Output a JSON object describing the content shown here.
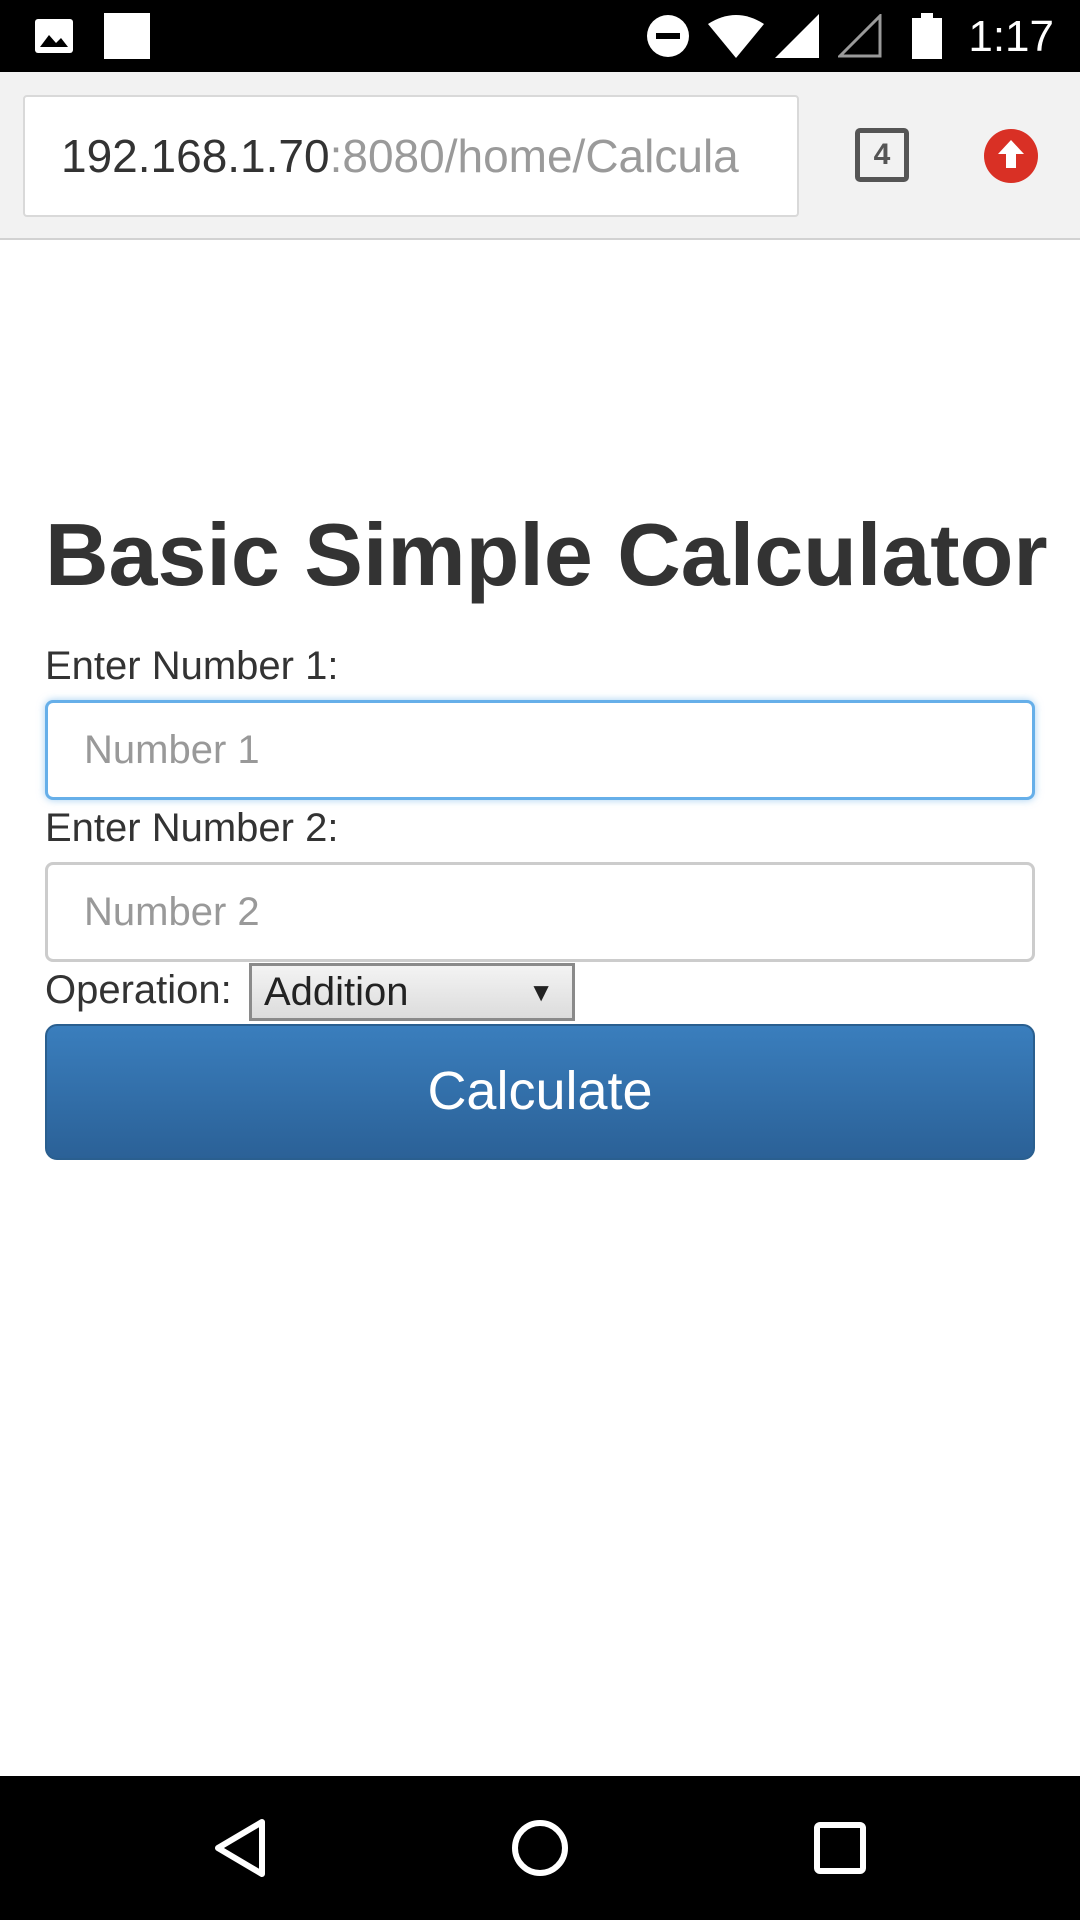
{
  "status_bar": {
    "time": "1:17",
    "icons": [
      "image-icon",
      "notification-square-icon",
      "do-not-disturb-icon",
      "wifi-icon",
      "signal-full-icon",
      "signal-empty-icon",
      "battery-icon"
    ]
  },
  "browser": {
    "url_host": "192.168.1.70",
    "url_path": ":8080/home/Calcula",
    "tab_count": "4",
    "update_badge_color": "#d93025"
  },
  "page": {
    "title": "Basic Simple Calculator",
    "number1": {
      "label": "Enter Number 1:",
      "placeholder": "Number 1",
      "value": ""
    },
    "number2": {
      "label": "Enter Number 2:",
      "placeholder": "Number 2",
      "value": ""
    },
    "operation": {
      "label": "Operation:",
      "selected": "Addition"
    },
    "calculate_label": "Calculate"
  },
  "colors": {
    "button": "#337ab7",
    "focus_border": "#66afe9",
    "text": "#333333"
  },
  "nav_bar": {
    "icons": [
      "back-icon",
      "home-icon",
      "recents-icon"
    ]
  }
}
